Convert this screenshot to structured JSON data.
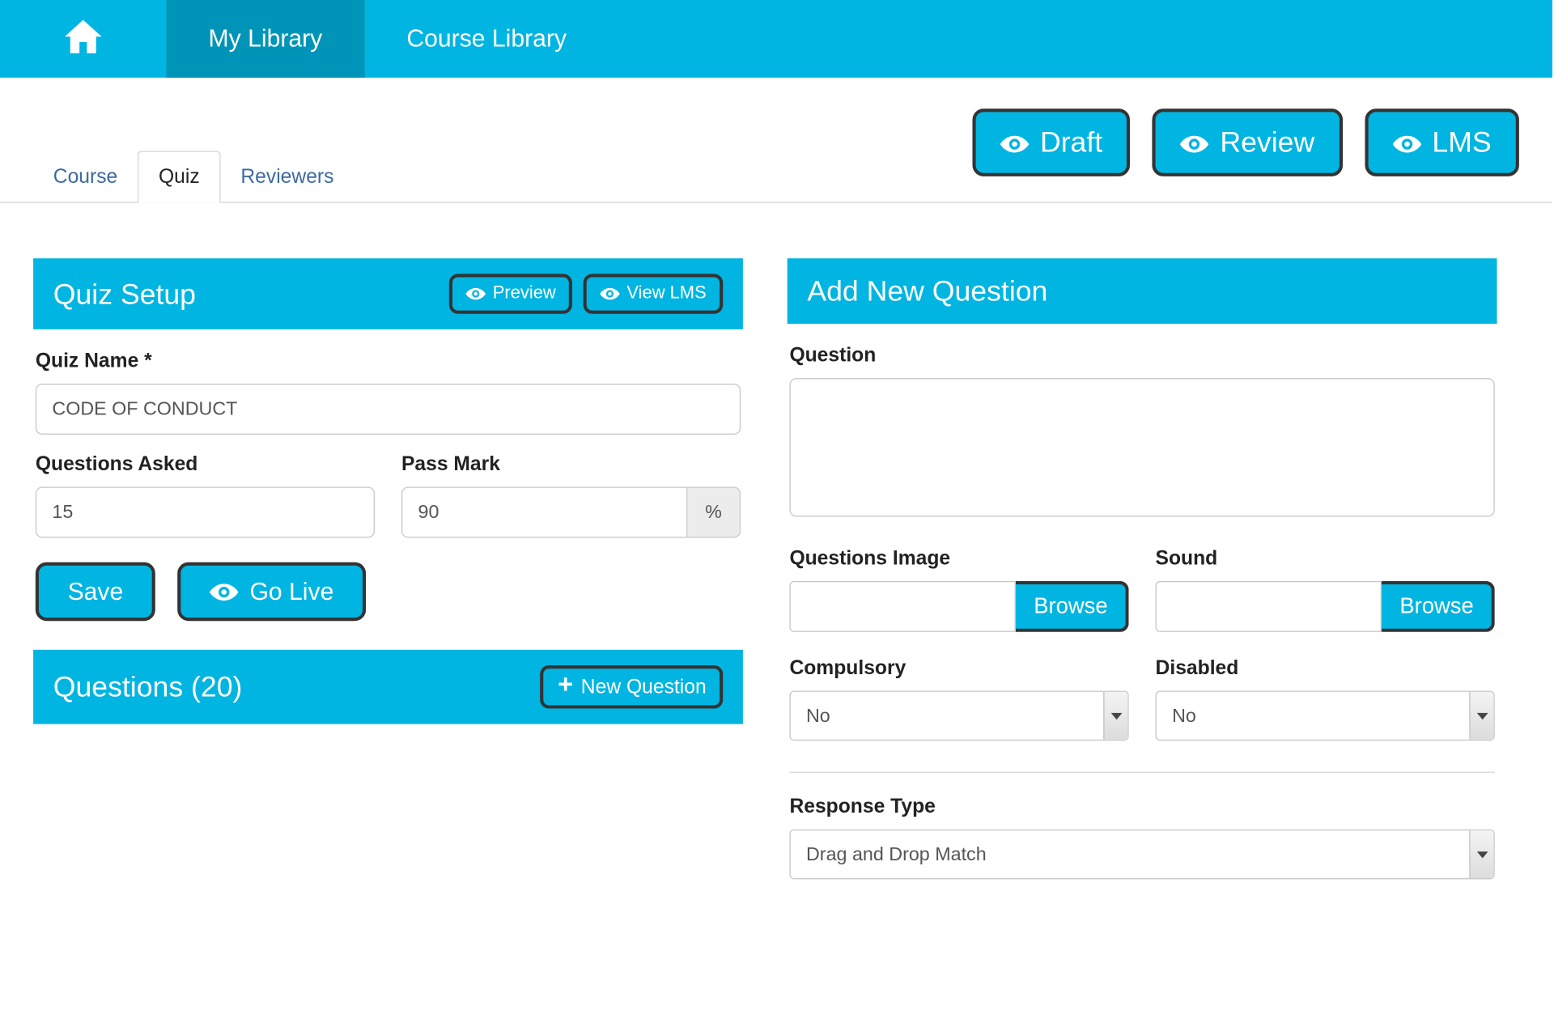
{
  "nav": {
    "my_library": "My Library",
    "course_library": "Course Library"
  },
  "preview_buttons": {
    "draft": "Draft",
    "review": "Review",
    "lms": "LMS"
  },
  "tabs": {
    "course": "Course",
    "quiz": "Quiz",
    "reviewers": "Reviewers"
  },
  "quiz_setup": {
    "title": "Quiz Setup",
    "preview_btn": "Preview",
    "view_lms_btn": "View LMS",
    "quiz_name_label": "Quiz Name *",
    "quiz_name_value": "CODE OF CONDUCT",
    "questions_asked_label": "Questions Asked",
    "questions_asked_value": "15",
    "pass_mark_label": "Pass Mark",
    "pass_mark_value": "90",
    "pass_mark_unit": "%",
    "save_btn": "Save",
    "go_live_btn": "Go Live"
  },
  "questions_panel": {
    "title": "Questions (20)",
    "new_question_btn": "New Question"
  },
  "add_question": {
    "title": "Add New Question",
    "question_label": "Question",
    "question_value": "",
    "image_label": "Questions Image",
    "image_value": "",
    "sound_label": "Sound",
    "sound_value": "",
    "browse_btn": "Browse",
    "compulsory_label": "Compulsory",
    "compulsory_value": "No",
    "disabled_label": "Disabled",
    "disabled_value": "No",
    "response_type_label": "Response Type",
    "response_type_value": "Drag and Drop Match"
  }
}
